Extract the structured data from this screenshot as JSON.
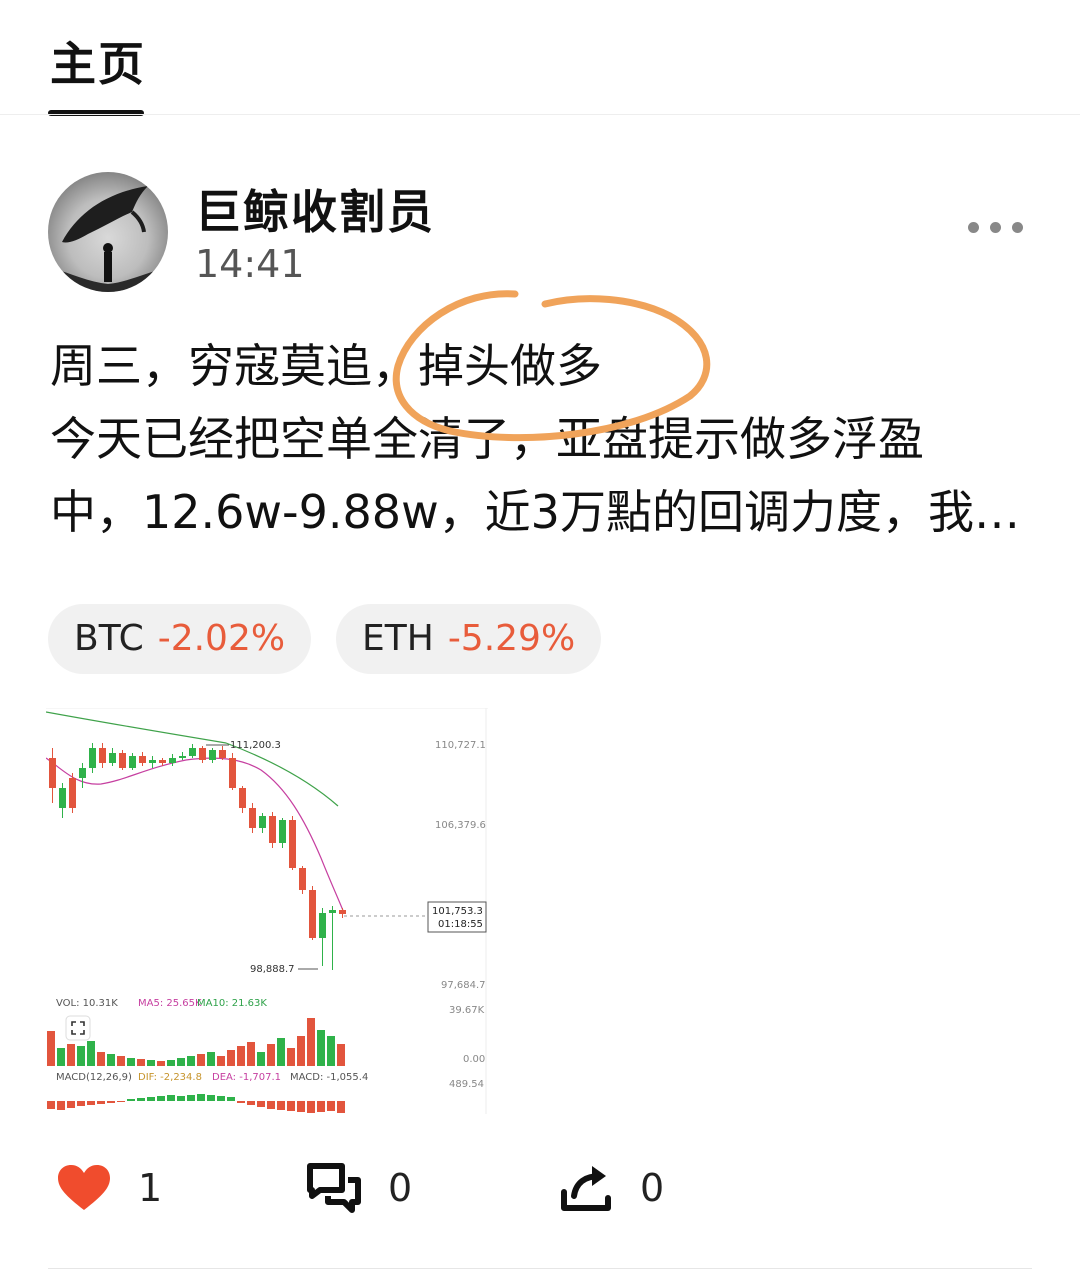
{
  "header": {
    "tab_label": "主页"
  },
  "post": {
    "author": "巨鲸收割员",
    "time": "14:41",
    "lines": [
      "周三，穷寇莫追，掉头做多",
      "今天已经把空单全清了，亚盘提示做多浮盈",
      "中，12.6w-9.88w，近3万點的回调力度，我…"
    ],
    "annotation_color": "#f0a35a"
  },
  "tickers": [
    {
      "symbol": "BTC",
      "change": "-2.02%"
    },
    {
      "symbol": "ETH",
      "change": "-5.29%"
    }
  ],
  "chart_image": {
    "labels": {
      "high": "111,200.3",
      "low": "98,888.7",
      "price_levels": [
        "110,727.1",
        "106,379.6",
        "97,684.7"
      ],
      "current_price": "101,753.3",
      "countdown": "01:18:55",
      "vol_line": "VOL: 10.31K",
      "vol_ma5": "MA5: 25.65K",
      "vol_ma10": "MA10: 21.63K",
      "vol_axis_top": "39.67K",
      "vol_axis_zero": "0.00",
      "macd_params": "MACD(12,26,9)",
      "dif": "DIF: -2,234.8",
      "dea": "DEA: -1,707.1",
      "macd": "MACD: -1,055.4",
      "macd_axis": "489.54"
    },
    "colors": {
      "up": "#2fb24a",
      "down": "#e2553d",
      "ma_long": "#3fa24a",
      "ma_short": "#c63fa0"
    }
  },
  "actions": {
    "likes": "1",
    "comments": "0",
    "shares": "0"
  }
}
